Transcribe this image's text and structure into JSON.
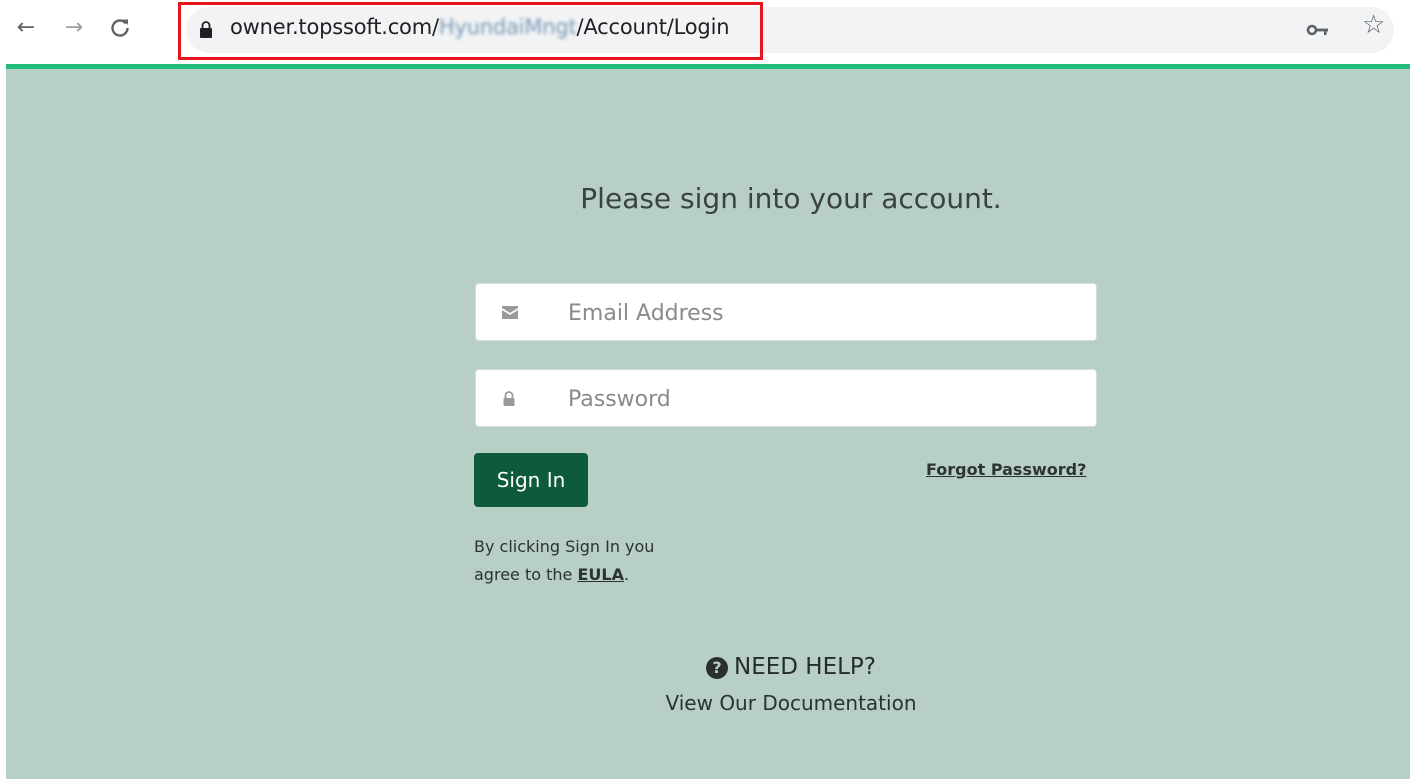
{
  "browser": {
    "url_host": "owner.topssoft.com/",
    "url_redacted": "HyundaiMngt",
    "url_path": "/Account/Login",
    "icons": [
      "back-arrow-icon",
      "forward-arrow-icon",
      "reload-icon",
      "lock-icon",
      "key-icon",
      "star-icon"
    ]
  },
  "login": {
    "heading": "Please sign into your account.",
    "email_placeholder": "Email Address",
    "password_placeholder": "Password",
    "sign_in_label": "Sign In",
    "forgot_password_label": "Forgot Password?",
    "eula_prefix": "By clicking Sign In you agree to the ",
    "eula_link": "EULA",
    "eula_suffix": "."
  },
  "help": {
    "title": "NEED HELP?",
    "link": "View Our Documentation"
  },
  "colors": {
    "page_background": "#b8cfc6",
    "accent": "#1fbc7a",
    "button": "#0d5a3c",
    "highlight_box": "#e8141e"
  }
}
